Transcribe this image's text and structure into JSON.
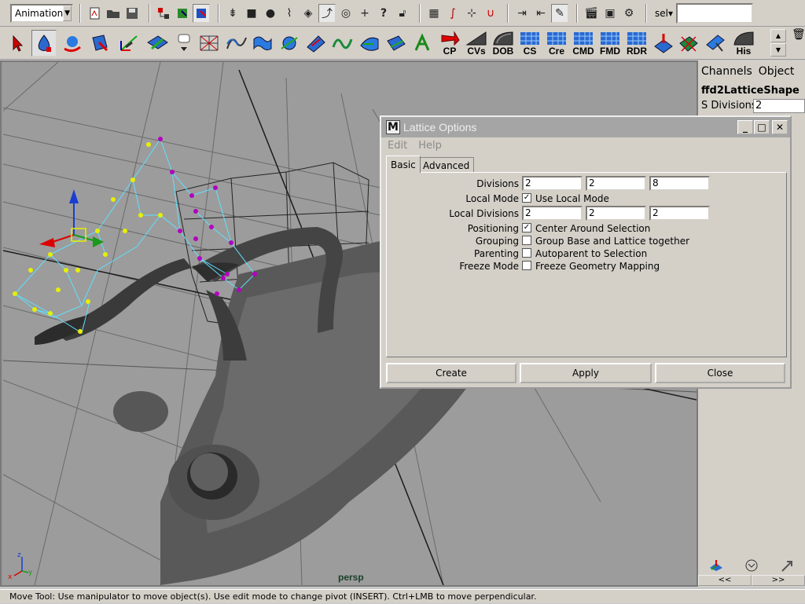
{
  "status_line": {
    "mode": "Animation",
    "select_label": "sel",
    "select_input_value": ""
  },
  "shelf": {
    "labeled_buttons": [
      "CP",
      "CVs",
      "DOB",
      "CS",
      "Cre",
      "CMD",
      "FMD",
      "RDR",
      "His"
    ]
  },
  "viewport": {
    "camera_name": "persp"
  },
  "channel_box": {
    "menu_channels": "Channels",
    "menu_object": "Object",
    "object_name": "ffd2LatticeShape",
    "attribute_label": "S Divisions",
    "attribute_value": "2",
    "scroll_left": "<<",
    "scroll_right": ">>"
  },
  "dialog": {
    "title": "Lattice Options",
    "menu_edit": "Edit",
    "menu_help": "Help",
    "tab_basic": "Basic",
    "tab_advanced": "Advanced",
    "divisions_label": "Divisions",
    "divisions": [
      "2",
      "2",
      "8"
    ],
    "local_mode_label": "Local Mode",
    "local_mode_text": "Use Local Mode",
    "local_mode_checked": true,
    "local_divisions_label": "Local Divisions",
    "local_divisions": [
      "2",
      "2",
      "2"
    ],
    "positioning_label": "Positioning",
    "positioning_text": "Center Around Selection",
    "positioning_checked": true,
    "grouping_label": "Grouping",
    "grouping_text": "Group Base and Lattice together",
    "grouping_checked": false,
    "parenting_label": "Parenting",
    "parenting_text": "Autoparent to Selection",
    "parenting_checked": false,
    "freeze_mode_label": "Freeze Mode",
    "freeze_mode_text": "Freeze Geometry Mapping",
    "freeze_mode_checked": false,
    "create_label": "Create",
    "apply_label": "Apply",
    "close_label": "Close"
  },
  "help_line": {
    "text": "Move Tool: Use manipulator to move object(s). Use edit mode to change pivot (INSERT).  Ctrl+LMB to move perpendicular."
  },
  "colors": {
    "ui_gray": "#d4d0c8",
    "viewport_bg": "#9a9a9a",
    "lattice_cyan": "#5fe0ff",
    "lattice_point": "#e6f000",
    "lattice_point_selected": "#b300c0",
    "camera_label": "#1a3f2a"
  }
}
